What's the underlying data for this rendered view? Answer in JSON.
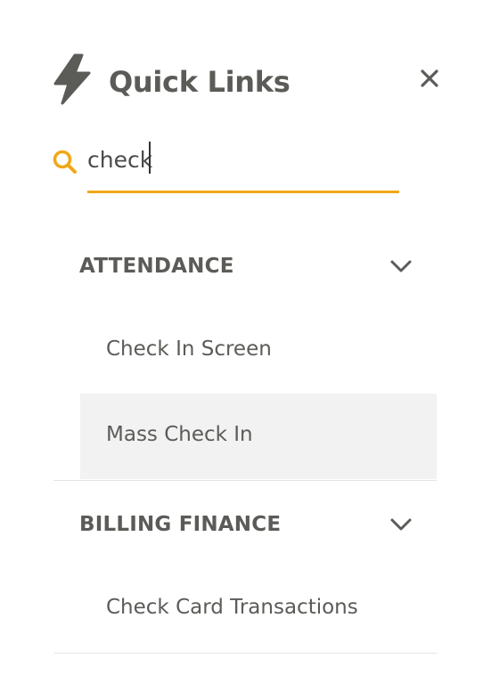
{
  "header": {
    "title": "Quick Links",
    "icon": "lightning-bolt-icon",
    "close_icon": "close-icon"
  },
  "search": {
    "value": "check",
    "icon": "search-icon",
    "accent_color": "#f0a817"
  },
  "sections": [
    {
      "title": "ATTENDANCE",
      "expanded": true,
      "items": [
        {
          "label": "Check In Screen"
        },
        {
          "label": "Mass Check In",
          "hovered": true
        }
      ]
    },
    {
      "title": "BILLING FINANCE",
      "expanded": true,
      "items": [
        {
          "label": "Check Card Transactions"
        }
      ]
    }
  ]
}
